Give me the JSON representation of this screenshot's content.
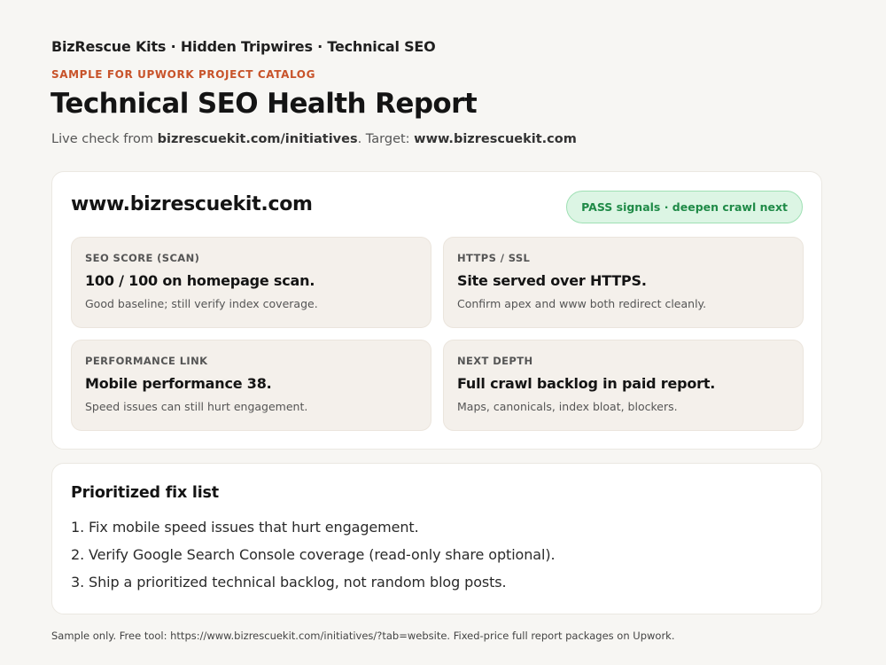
{
  "header": {
    "breadcrumb": "BizRescue Kits · Hidden Tripwires · Technical SEO",
    "eyebrow": "SAMPLE FOR UPWORK PROJECT CATALOG",
    "title": "Technical SEO Health Report",
    "subtitle_prefix": "Live check from ",
    "subtitle_source": "bizrescuekit.com/initiatives",
    "subtitle_mid": ". Target: ",
    "subtitle_target": "www.bizrescuekit.com"
  },
  "summary": {
    "site": "www.bizrescuekit.com",
    "status_badge": "PASS signals · deepen crawl next",
    "status_color": "#1f8a47",
    "tiles": [
      {
        "label": "SEO SCORE (SCAN)",
        "headline": "100 / 100 on homepage scan.",
        "note": "Good baseline; still verify index coverage."
      },
      {
        "label": "HTTPS / SSL",
        "headline": "Site served over HTTPS.",
        "note": "Confirm apex and www both redirect cleanly."
      },
      {
        "label": "PERFORMANCE LINK",
        "headline": "Mobile performance 38.",
        "note": "Speed issues can still hurt engagement."
      },
      {
        "label": "NEXT DEPTH",
        "headline": "Full crawl backlog in paid report.",
        "note": "Maps, canonicals, index bloat, blockers."
      }
    ]
  },
  "fixes": {
    "title": "Prioritized fix list",
    "items": [
      "1. Fix mobile speed issues that hurt engagement.",
      "2. Verify Google Search Console coverage (read-only share optional).",
      "3. Ship a prioritized technical backlog, not random blog posts."
    ]
  },
  "footer": "Sample only. Free tool: https://www.bizrescuekit.com/initiatives/?tab=website. Fixed-price full report packages on Upwork.",
  "colors": {
    "accent": "#c8532a",
    "pass_bg": "#dcf5e4",
    "tile_bg": "#f4f0eb",
    "page_bg": "#f7f6f3"
  }
}
